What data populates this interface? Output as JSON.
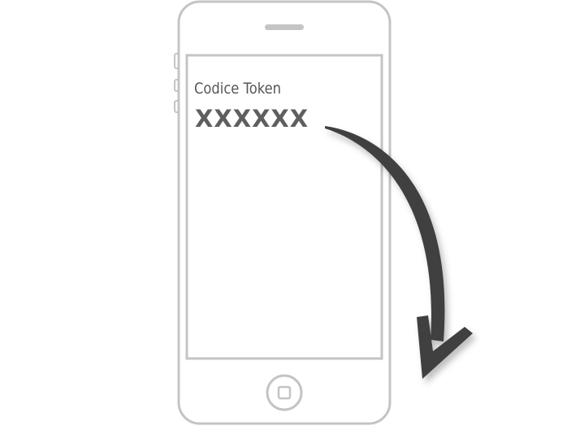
{
  "screen": {
    "label": "Codice Token",
    "token_value": "XXXXXX"
  },
  "icons": {
    "phone": "smartphone-icon",
    "home_button": "home-button-icon",
    "speaker": "speaker-slot-icon",
    "arrow": "curved-arrow-down-icon"
  },
  "colors": {
    "phone_outline": "#c4c4c4",
    "text": "#555555",
    "arrow": "#404040"
  }
}
